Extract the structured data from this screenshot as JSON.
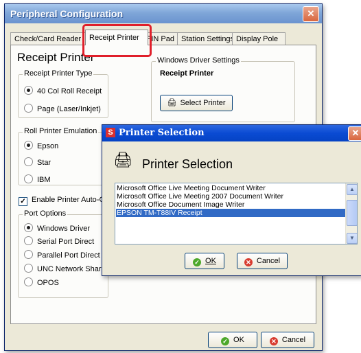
{
  "main_window": {
    "title": "Peripheral Configuration",
    "tabs": [
      {
        "label": "Check/Card Reader"
      },
      {
        "label": "Receipt Printer"
      },
      {
        "label": "PIN Pad"
      },
      {
        "label": "Station Settings"
      },
      {
        "label": "Display Pole"
      }
    ],
    "heading": "Receipt Printer",
    "receipt_printer_type": {
      "label": "Receipt Printer Type",
      "options": [
        "40 Col Roll Receipt",
        "Page (Laser/Inkjet)"
      ],
      "selected": "40 Col Roll Receipt"
    },
    "roll_printer_emulation": {
      "label": "Roll Printer Emulation",
      "options": [
        "Epson",
        "Star",
        "IBM"
      ],
      "selected": "Epson"
    },
    "auto_cut": {
      "label": "Enable Printer Auto-Cut",
      "checked": true
    },
    "port_options": {
      "label": "Port Options",
      "options": [
        "Windows Driver",
        "Serial Port Direct",
        "Parallel Port Direct",
        "UNC Network Share",
        "OPOS"
      ],
      "selected": "Windows Driver"
    },
    "windows_driver_settings": {
      "label": "Windows Driver Settings",
      "printer_name": "Receipt Printer",
      "select_button": "Select Printer"
    },
    "ok_label": "OK",
    "cancel_label": "Cancel"
  },
  "printer_dialog": {
    "title": "Printer Selection",
    "heading": "Printer Selection",
    "printers": [
      "Microsoft Office Live Meeting Document Writer",
      "Microsoft Office Live Meeting 2007 Document Writer",
      "Microsoft Office Document Image Writer",
      "EPSON TM-T88IV Receipt"
    ],
    "selected_printer": "EPSON TM-T88IV Receipt",
    "ok_label": "OK",
    "cancel_label": "Cancel"
  },
  "colors": {
    "highlight_ring": "#e01f2a",
    "selection": "#316ac5",
    "dialog_title": "#0a4bd3"
  }
}
